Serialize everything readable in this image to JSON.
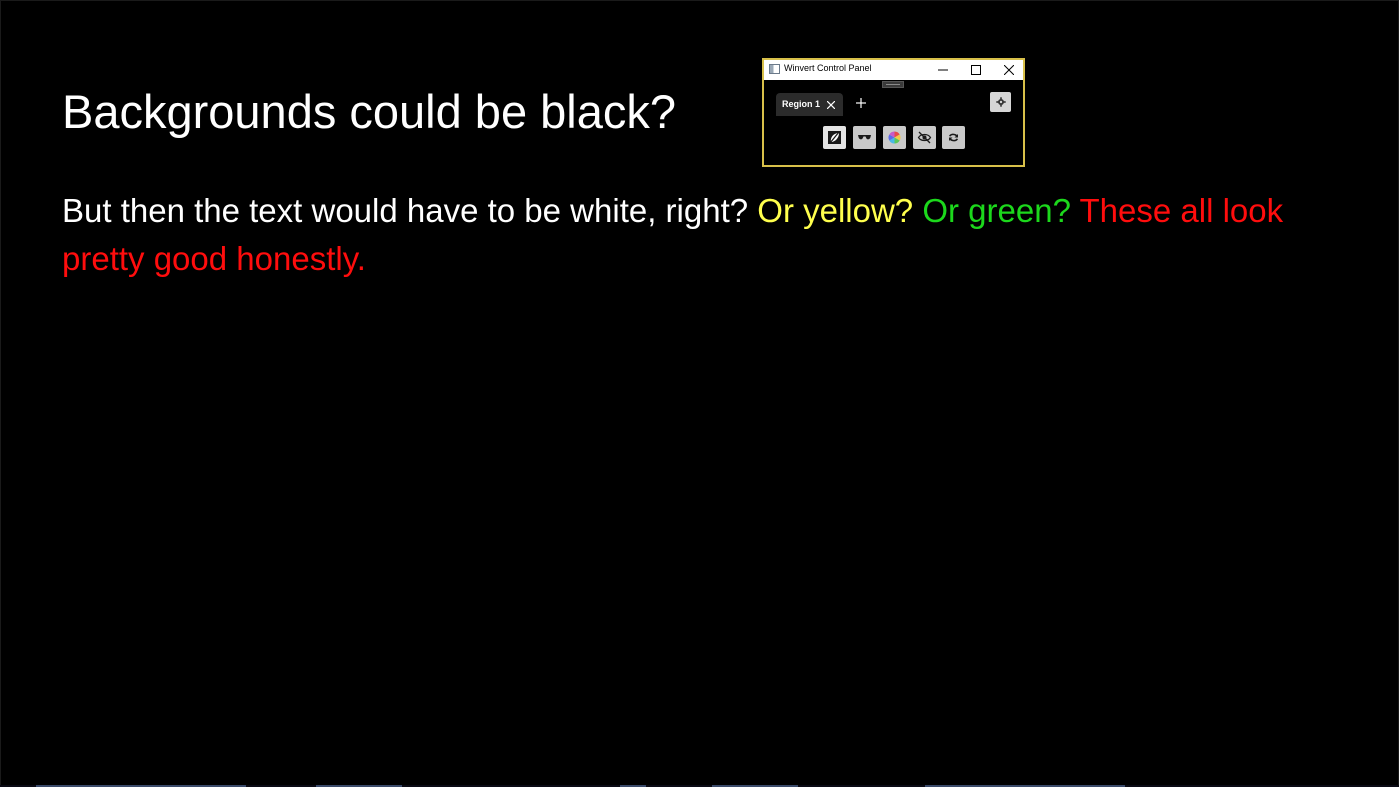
{
  "slide": {
    "title": "Backgrounds could be black?",
    "body": {
      "white_text": "But then the text would have to be white, right? ",
      "yellow_text": "Or yellow? ",
      "green_text": "Or green? ",
      "red_text": "These all look pretty good honestly."
    }
  },
  "colors": {
    "background": "#000000",
    "white": "#ffffff",
    "yellow": "#ffff4d",
    "green": "#1cd81c",
    "red": "#ff0d0d",
    "window_border": "#d8c04a"
  },
  "control_panel": {
    "window_title": "Winvert Control Panel",
    "tabs": [
      {
        "label": "Region 1"
      }
    ],
    "icons": {
      "app": "app-icon",
      "minimize": "minimize-icon",
      "maximize": "maximize-icon",
      "close": "close-icon",
      "tab_close": "close-icon",
      "add_tab": "plus-icon",
      "settings": "gear-icon",
      "tools": [
        "invert-icon",
        "sunglasses-icon",
        "color-wheel-icon",
        "eye-hidden-icon",
        "swap-arrows-icon"
      ]
    }
  }
}
